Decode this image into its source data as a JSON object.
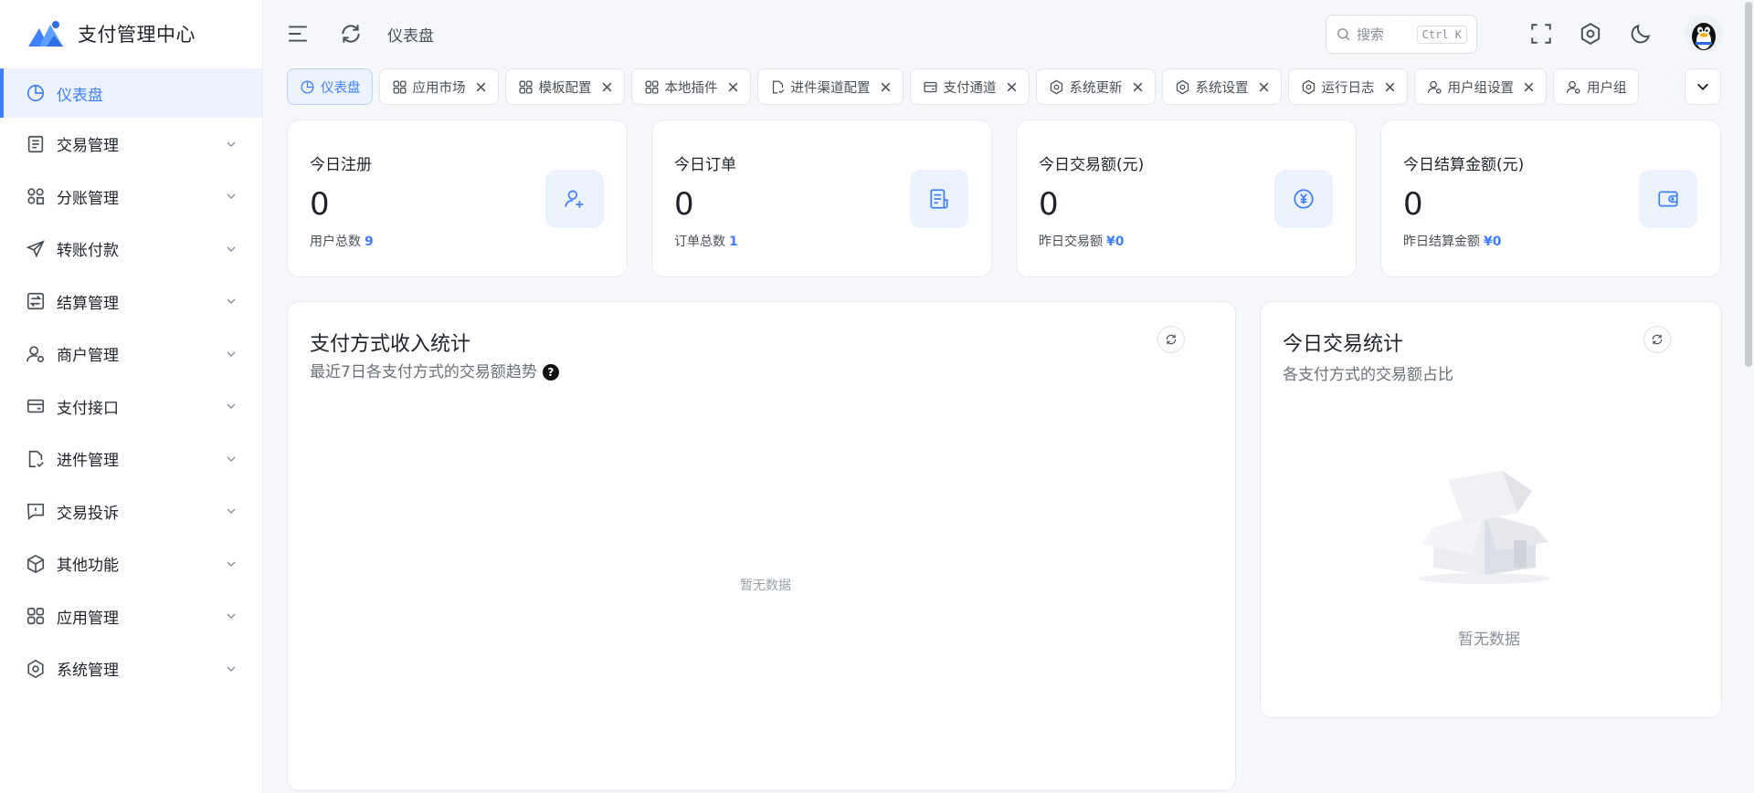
{
  "app": {
    "title": "支付管理中心"
  },
  "sidebar": {
    "items": [
      {
        "label": "仪表盘",
        "icon": "pie-chart-icon",
        "active": true
      },
      {
        "label": "交易管理",
        "icon": "document-icon"
      },
      {
        "label": "分账管理",
        "icon": "split-icon"
      },
      {
        "label": "转账付款",
        "icon": "send-icon"
      },
      {
        "label": "结算管理",
        "icon": "settlement-icon"
      },
      {
        "label": "商户管理",
        "icon": "user-gear-icon"
      },
      {
        "label": "支付接口",
        "icon": "card-icon"
      },
      {
        "label": "进件管理",
        "icon": "file-check-icon"
      },
      {
        "label": "交易投诉",
        "icon": "complaint-icon"
      },
      {
        "label": "其他功能",
        "icon": "cube-icon"
      },
      {
        "label": "应用管理",
        "icon": "apps-icon"
      },
      {
        "label": "系统管理",
        "icon": "hexagon-gear-icon"
      }
    ]
  },
  "header": {
    "breadcrumb": "仪表盘",
    "search_placeholder": "搜索",
    "search_shortcut": "Ctrl K"
  },
  "tabs": [
    {
      "label": "仪表盘",
      "icon": "pie-chart-icon",
      "active": true,
      "closable": false
    },
    {
      "label": "应用市场",
      "icon": "apps-icon",
      "closable": true
    },
    {
      "label": "模板配置",
      "icon": "apps-icon",
      "closable": true
    },
    {
      "label": "本地插件",
      "icon": "apps-icon",
      "closable": true
    },
    {
      "label": "进件渠道配置",
      "icon": "file-check-icon",
      "closable": true
    },
    {
      "label": "支付通道",
      "icon": "card-icon",
      "closable": true
    },
    {
      "label": "系统更新",
      "icon": "hexagon-gear-icon",
      "closable": true
    },
    {
      "label": "系统设置",
      "icon": "hexagon-gear-icon",
      "closable": true
    },
    {
      "label": "运行日志",
      "icon": "hexagon-gear-icon",
      "closable": true
    },
    {
      "label": "用户组设置",
      "icon": "user-gear-icon",
      "closable": true
    },
    {
      "label": "用户组",
      "icon": "user-gear-icon",
      "closable": true
    }
  ],
  "stats": [
    {
      "label": "今日注册",
      "value": "0",
      "sub_label": "用户总数",
      "sub_value": "9",
      "icon": "user-add-icon"
    },
    {
      "label": "今日订单",
      "value": "0",
      "sub_label": "订单总数",
      "sub_value": "1",
      "icon": "order-icon"
    },
    {
      "label": "今日交易额(元)",
      "value": "0",
      "sub_label": "昨日交易额",
      "sub_value": "¥0",
      "icon": "yuan-icon"
    },
    {
      "label": "今日结算金额(元)",
      "value": "0",
      "sub_label": "昨日结算金额",
      "sub_value": "¥0",
      "icon": "wallet-icon"
    }
  ],
  "income_panel": {
    "title": "支付方式收入统计",
    "subtitle": "最近7日各支付方式的交易额趋势",
    "help": "?",
    "empty": "暂无数据"
  },
  "today_panel": {
    "title": "今日交易统计",
    "subtitle": "各支付方式的交易额占比",
    "empty": "暂无数据"
  },
  "colors": {
    "accent": "#4080ff",
    "accent_bg": "#ecf3ff",
    "page_bg": "#f5f7fa"
  }
}
